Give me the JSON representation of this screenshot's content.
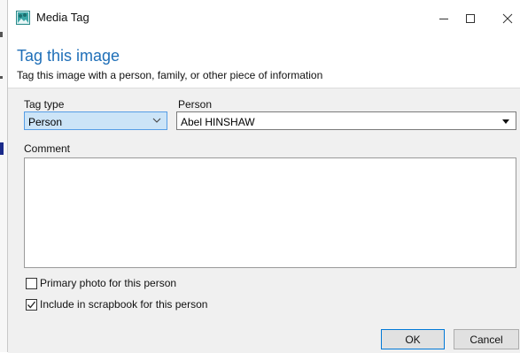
{
  "window": {
    "title": "Media Tag",
    "app_icon": "media-tag-app-icon",
    "controls": [
      "minimize-icon",
      "maximize-icon",
      "close-icon"
    ]
  },
  "header": {
    "heading": "Tag this image",
    "subheading": "Tag this image with a person, family, or other piece of information"
  },
  "form": {
    "tag_type": {
      "label": "Tag type",
      "value": "Person"
    },
    "person": {
      "label": "Person",
      "value": "Abel HINSHAW"
    },
    "comment": {
      "label": "Comment",
      "value": ""
    },
    "primary_photo": {
      "label": "Primary photo for this person",
      "checked": false
    },
    "include_scrapbook": {
      "label": "Include in scrapbook for this person",
      "checked": true
    }
  },
  "buttons": {
    "ok": "OK",
    "cancel": "Cancel"
  },
  "colors": {
    "heading": "#1f6fb8",
    "accent": "#0078d7",
    "body_bg": "#f0f0f0",
    "select_highlight": "#cce4f7"
  }
}
